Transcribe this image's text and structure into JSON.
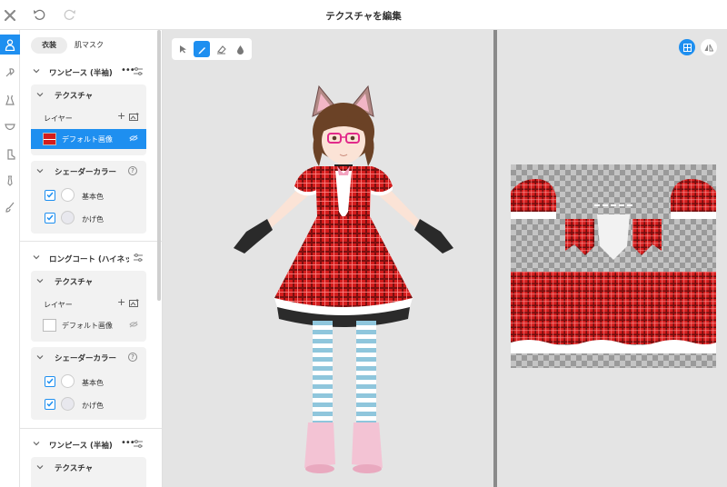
{
  "window": {
    "title": "テクスチャを編集"
  },
  "tabs": [
    {
      "label": "衣装",
      "active": true
    },
    {
      "label": "肌マスク",
      "active": false
    }
  ],
  "sections": [
    {
      "name": "ワンピース (半袖)",
      "texture_title": "テクスチャ",
      "layer_label": "レイヤー",
      "layer_name": "デフォルト画像",
      "layer_selected": true,
      "shader_title": "シェーダーカラー",
      "colors": [
        {
          "label": "基本色",
          "swatch": "#ffffff",
          "checked": true
        },
        {
          "label": "かげ色",
          "swatch": "#e8e8ee",
          "checked": true
        }
      ]
    },
    {
      "name": "ロングコート (ハイネック)",
      "texture_title": "テクスチャ",
      "layer_label": "レイヤー",
      "layer_name": "デフォルト画像",
      "layer_selected": false,
      "shader_title": "シェーダーカラー",
      "colors": [
        {
          "label": "基本色",
          "swatch": "#ffffff",
          "checked": true
        },
        {
          "label": "かげ色",
          "swatch": "#e8e8ee",
          "checked": true
        }
      ]
    },
    {
      "name": "ワンピース (半袖)",
      "texture_title": "テクスチャ"
    }
  ],
  "icons": {
    "top": [
      "close-icon",
      "undo-icon",
      "redo-icon"
    ],
    "rail": [
      "body-icon",
      "hair-brush-icon",
      "dress-icon",
      "underwear-icon",
      "sock-icon",
      "tie-icon",
      "brush-icon"
    ],
    "tools": [
      "select-arrow-icon",
      "pencil-icon",
      "eraser-icon",
      "fill-icon"
    ],
    "view": [
      "grid-view-icon",
      "mirror-icon"
    ]
  },
  "colors": {
    "accent": "#1e8ff0",
    "canvas_bg": "#e4e4e4",
    "plaid_red": "#d41c1c",
    "plaid_dark": "#5a0c0c"
  },
  "selected_tool": "pencil-icon"
}
